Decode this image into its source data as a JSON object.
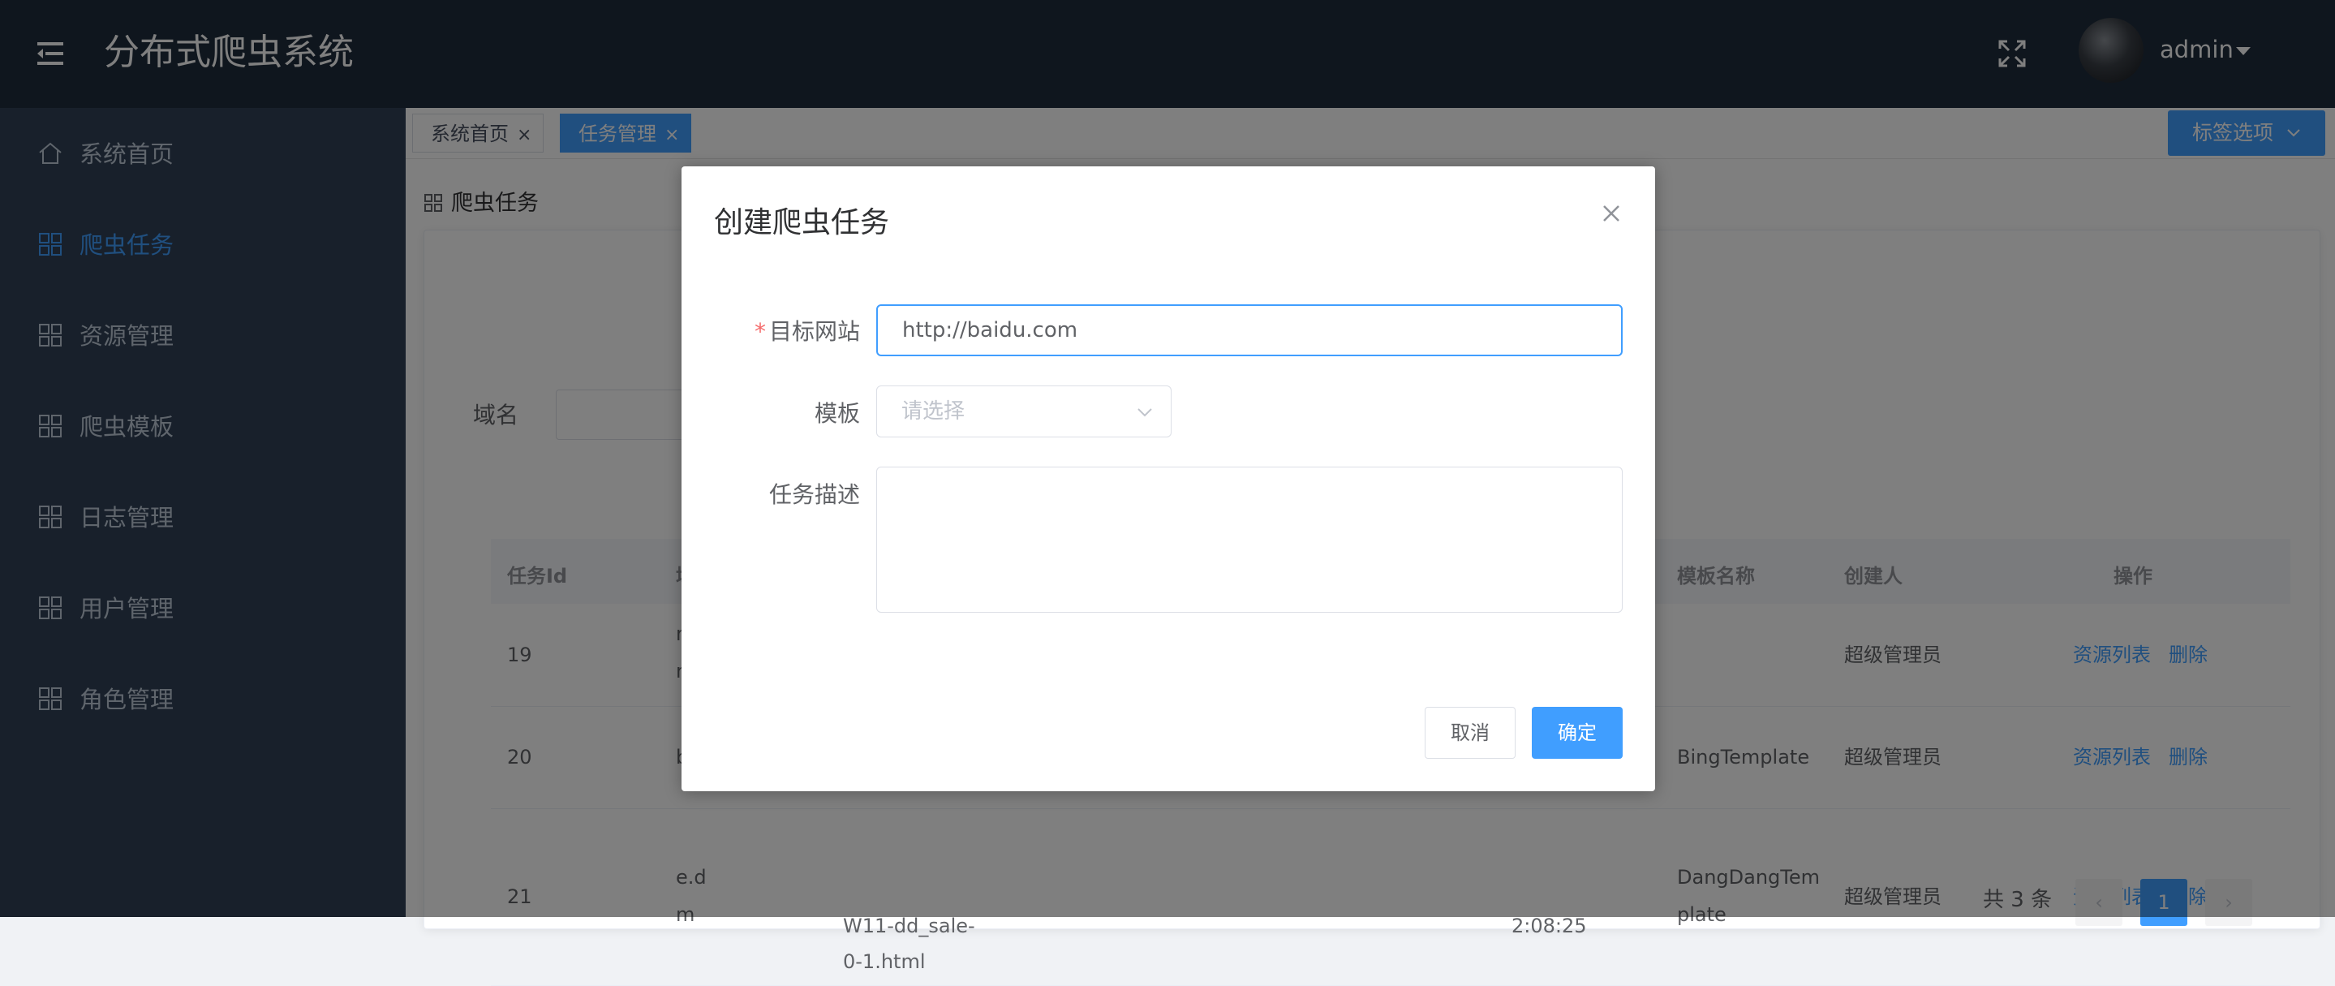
{
  "header": {
    "title": "分布式爬虫系统",
    "username": "admin",
    "icons": {
      "menu": "menu-fold-icon",
      "fullscreen": "fullscreen-icon",
      "caret": "caret-down-icon"
    }
  },
  "sidebar": {
    "items": [
      {
        "label": "系统首页",
        "icon": "home-icon"
      },
      {
        "label": "爬虫任务",
        "icon": "grid-icon",
        "active": true
      },
      {
        "label": "资源管理",
        "icon": "grid-icon"
      },
      {
        "label": "爬虫模板",
        "icon": "grid-icon"
      },
      {
        "label": "日志管理",
        "icon": "grid-icon"
      },
      {
        "label": "用户管理",
        "icon": "grid-icon"
      },
      {
        "label": "角色管理",
        "icon": "grid-icon"
      }
    ]
  },
  "tags": {
    "items": [
      {
        "label": "系统首页",
        "close": "×"
      },
      {
        "label": "任务管理",
        "close": "×",
        "active": true
      }
    ],
    "options_label": "标签选项"
  },
  "page": {
    "heading": "爬虫任务",
    "filter": {
      "label": "域名",
      "value": ""
    },
    "table": {
      "columns": [
        "任务Id",
        "域名",
        "模板名称",
        "创建人",
        "操作"
      ],
      "rows": [
        {
          "id": "19",
          "domain_lines": [
            "new",
            "m"
          ],
          "url_lines": [],
          "time_lines": [],
          "template_lines": [
            ""
          ],
          "creator": "超级管理员",
          "actions": [
            "资源列表",
            "删除"
          ]
        },
        {
          "id": "20",
          "domain_lines": [
            "bin"
          ],
          "url_lines": [],
          "time_lines": [],
          "template_lines": [
            "BingTemplate"
          ],
          "creator": "超级管理员",
          "actions": [
            "资源列表",
            "删除"
          ]
        },
        {
          "id": "21",
          "domain_lines": [
            "e.d",
            "m"
          ],
          "url_lines": [
            "W11-dd_sale-",
            "0-1.html"
          ],
          "time_lines": [
            "2:08:25"
          ],
          "template_lines": [
            "DangDangTem",
            "plate"
          ],
          "creator": "超级管理员",
          "actions": [
            "资源列表",
            "删除"
          ]
        }
      ]
    },
    "pagination": {
      "total": "共 3 条",
      "prev": "‹",
      "current": "1",
      "next": "›"
    }
  },
  "dialog": {
    "title": "创建爬虫任务",
    "close_icon": "close-icon",
    "fields": {
      "target_site": {
        "required_mark": "*",
        "label": "目标网站",
        "value": "http://baidu.com"
      },
      "template": {
        "label": "模板",
        "placeholder": "请选择"
      },
      "description": {
        "label": "任务描述",
        "value": ""
      }
    },
    "buttons": {
      "cancel": "取消",
      "confirm": "确定"
    }
  },
  "colors": {
    "primary": "#409eff",
    "sidebar_bg": "#304156",
    "header_bg": "#1f2d3d"
  }
}
